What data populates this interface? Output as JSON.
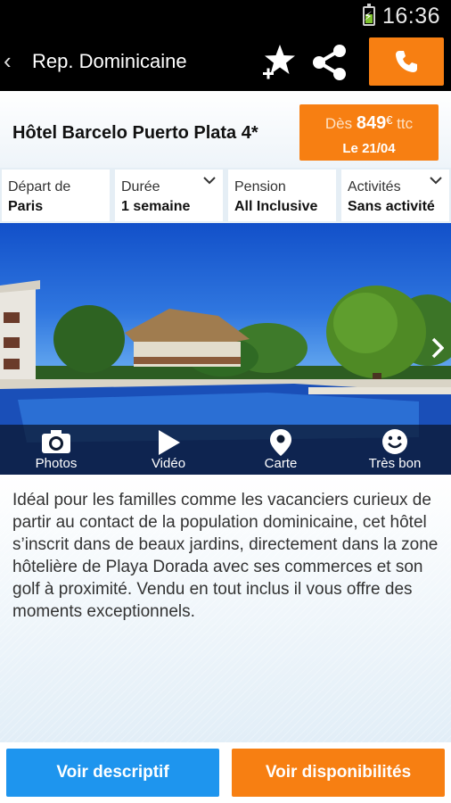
{
  "status_bar": {
    "time": "16:36",
    "battery_icon": "battery-charging-icon"
  },
  "action_bar": {
    "back_icon": "chevron-left-icon",
    "title": "Rep. Dominicaine",
    "favorite_icon": "star-add-icon",
    "share_icon": "share-icon",
    "call_icon": "phone-icon"
  },
  "hotel": {
    "name": "Hôtel Barcelo Puerto Plata 4*",
    "price": {
      "from": "Dès",
      "amount": "849",
      "currency": "€",
      "suffix": "ttc",
      "date": "Le 21/04"
    }
  },
  "filters": [
    {
      "label": "Départ de",
      "value": "Paris",
      "dropdown": false
    },
    {
      "label": "Durée",
      "value": "1 semaine",
      "dropdown": true
    },
    {
      "label": "Pension",
      "value": "All Inclusive",
      "dropdown": false
    },
    {
      "label": "Activités",
      "value": "Sans activité",
      "dropdown": true
    }
  ],
  "gallery": {
    "next_icon": "chevron-right-icon",
    "media": [
      {
        "label": "Photos",
        "icon": "camera-icon"
      },
      {
        "label": "Vidéo",
        "icon": "play-icon"
      },
      {
        "label": "Carte",
        "icon": "map-pin-icon"
      },
      {
        "label": "Très bon",
        "icon": "smiley-icon"
      }
    ]
  },
  "description": "Idéal pour les familles comme les vacanciers curieux de partir au contact de la population dominicaine, cet hôtel s’inscrit dans de beaux jardins, directement dans la zone hôtelière de Playa Dorada avec ses commerces et son golf à proximité. Vendu en tout inclus il vous offre des moments exceptionnels.",
  "buttons": {
    "descriptif": "Voir descriptif",
    "disponibilites": "Voir disponibilités"
  },
  "colors": {
    "accent_orange": "#f77f12",
    "accent_blue": "#1e95ee",
    "bar_black": "#000000"
  }
}
